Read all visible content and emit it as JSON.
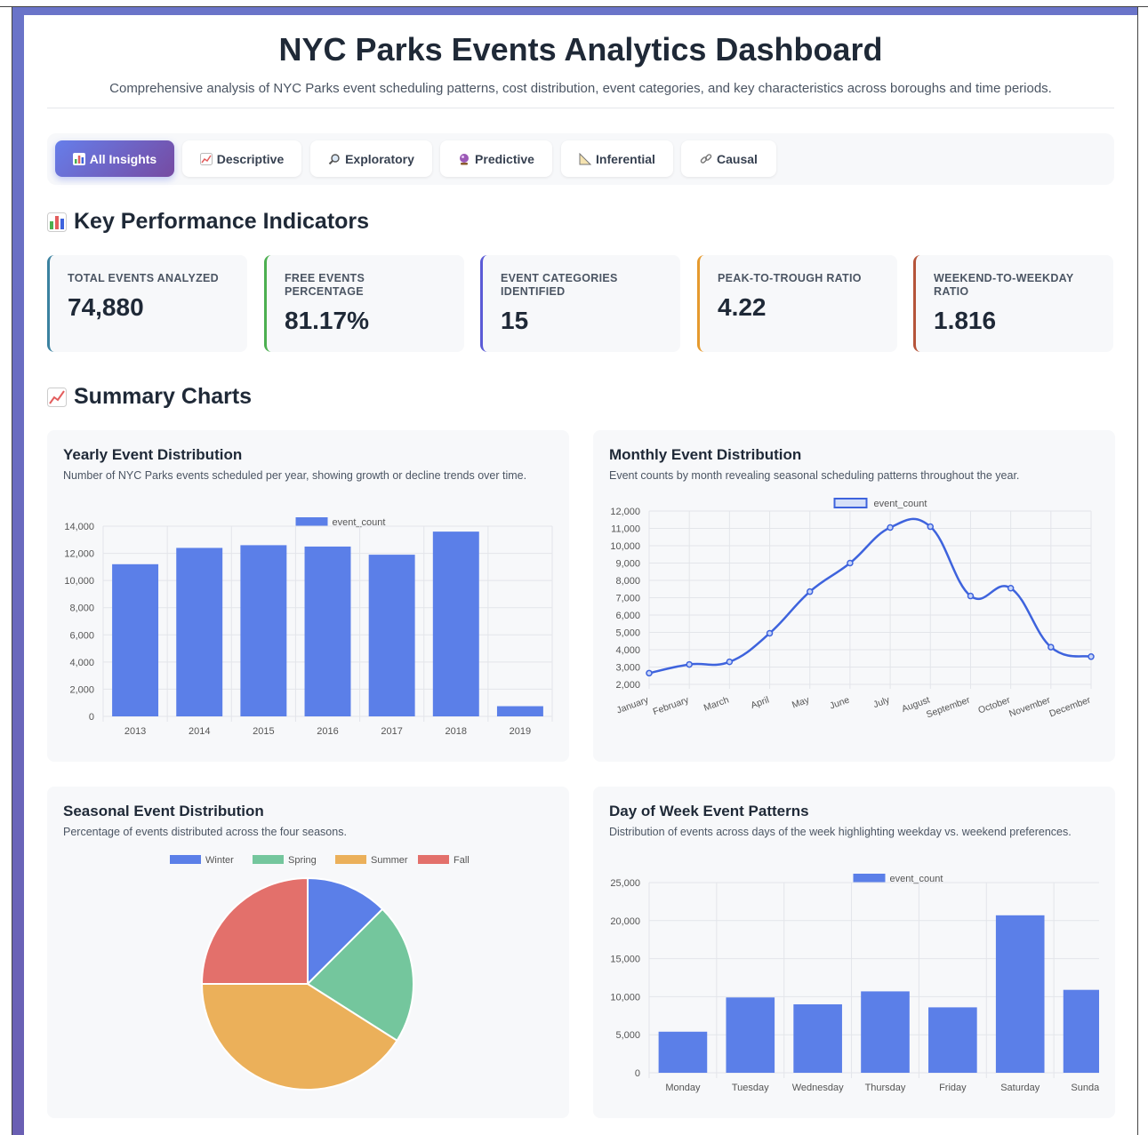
{
  "header": {
    "title": "NYC Parks Events Analytics Dashboard",
    "subtitle": "Comprehensive analysis of NYC Parks event scheduling patterns, cost distribution, event categories, and key characteristics across boroughs and time periods."
  },
  "tabs": [
    {
      "label": "All Insights",
      "icon": "bar-chart-icon",
      "active": true
    },
    {
      "label": "Descriptive",
      "icon": "trend-chart-icon",
      "active": false
    },
    {
      "label": "Exploratory",
      "icon": "magnifier-icon",
      "active": false
    },
    {
      "label": "Predictive",
      "icon": "crystal-ball-icon",
      "active": false
    },
    {
      "label": "Inferential",
      "icon": "triangle-ruler-icon",
      "active": false
    },
    {
      "label": "Causal",
      "icon": "link-icon",
      "active": false
    }
  ],
  "sections": {
    "kpi_title": "Key Performance Indicators",
    "charts_title": "Summary Charts"
  },
  "kpis": [
    {
      "label": "Total Events Analyzed",
      "value": "74,880",
      "accent": "#3b82a0"
    },
    {
      "label": "Free Events Percentage",
      "value": "81.17%",
      "accent": "#4caf50"
    },
    {
      "label": "Event Categories Identified",
      "value": "15",
      "accent": "#5b5bd6"
    },
    {
      "label": "Peak-To-Trough Ratio",
      "value": "4.22",
      "accent": "#e69a2e"
    },
    {
      "label": "Weekend-To-Weekday Ratio",
      "value": "1.816",
      "accent": "#b5543a"
    }
  ],
  "cards": {
    "yearly": {
      "title": "Yearly Event Distribution",
      "desc": "Number of NYC Parks events scheduled per year, showing growth or decline trends over time."
    },
    "monthly": {
      "title": "Monthly Event Distribution",
      "desc": "Event counts by month revealing seasonal scheduling patterns throughout the year."
    },
    "seasonal": {
      "title": "Seasonal Event Distribution",
      "desc": "Percentage of events distributed across the four seasons."
    },
    "weekday": {
      "title": "Day of Week Event Patterns",
      "desc": "Distribution of events across days of the week highlighting weekday vs. weekend preferences."
    }
  },
  "colors": {
    "bar": "#5b7fe8",
    "line": "#3e63dd",
    "winter": "#5b7fe8",
    "spring": "#74c69d",
    "summer": "#ebb05a",
    "fall": "#e3706b"
  },
  "chart_data": [
    {
      "type": "bar",
      "legend": "event_count",
      "categories": [
        "2013",
        "2014",
        "2015",
        "2016",
        "2017",
        "2018",
        "2019"
      ],
      "values": [
        11200,
        12400,
        12600,
        12500,
        11900,
        13600,
        750
      ],
      "ylim": [
        0,
        14000
      ],
      "yticks": [
        "0",
        "2,000",
        "4,000",
        "6,000",
        "8,000",
        "10,000",
        "12,000",
        "14,000"
      ]
    },
    {
      "type": "line",
      "legend": "event_count",
      "categories": [
        "January",
        "February",
        "March",
        "April",
        "May",
        "June",
        "July",
        "August",
        "September",
        "October",
        "November",
        "December"
      ],
      "values": [
        2650,
        3150,
        3300,
        4950,
        7350,
        9000,
        11050,
        11100,
        7100,
        7550,
        4150,
        3600
      ],
      "ylim": [
        2000,
        12000
      ],
      "yticks": [
        "2,000",
        "3,000",
        "4,000",
        "5,000",
        "6,000",
        "7,000",
        "8,000",
        "9,000",
        "10,000",
        "11,000",
        "12,000"
      ]
    },
    {
      "type": "pie",
      "labels": [
        "Winter",
        "Spring",
        "Summer",
        "Fall"
      ],
      "values": [
        12.5,
        21.5,
        41,
        25
      ]
    },
    {
      "type": "bar",
      "legend": "event_count",
      "categories": [
        "Monday",
        "Tuesday",
        "Wednesday",
        "Thursday",
        "Friday",
        "Saturday",
        "Sunday"
      ],
      "values": [
        5400,
        9900,
        9000,
        10700,
        8600,
        20700,
        10900
      ],
      "ylim": [
        0,
        25000
      ],
      "yticks": [
        "0",
        "5,000",
        "10,000",
        "15,000",
        "20,000",
        "25,000"
      ]
    }
  ]
}
